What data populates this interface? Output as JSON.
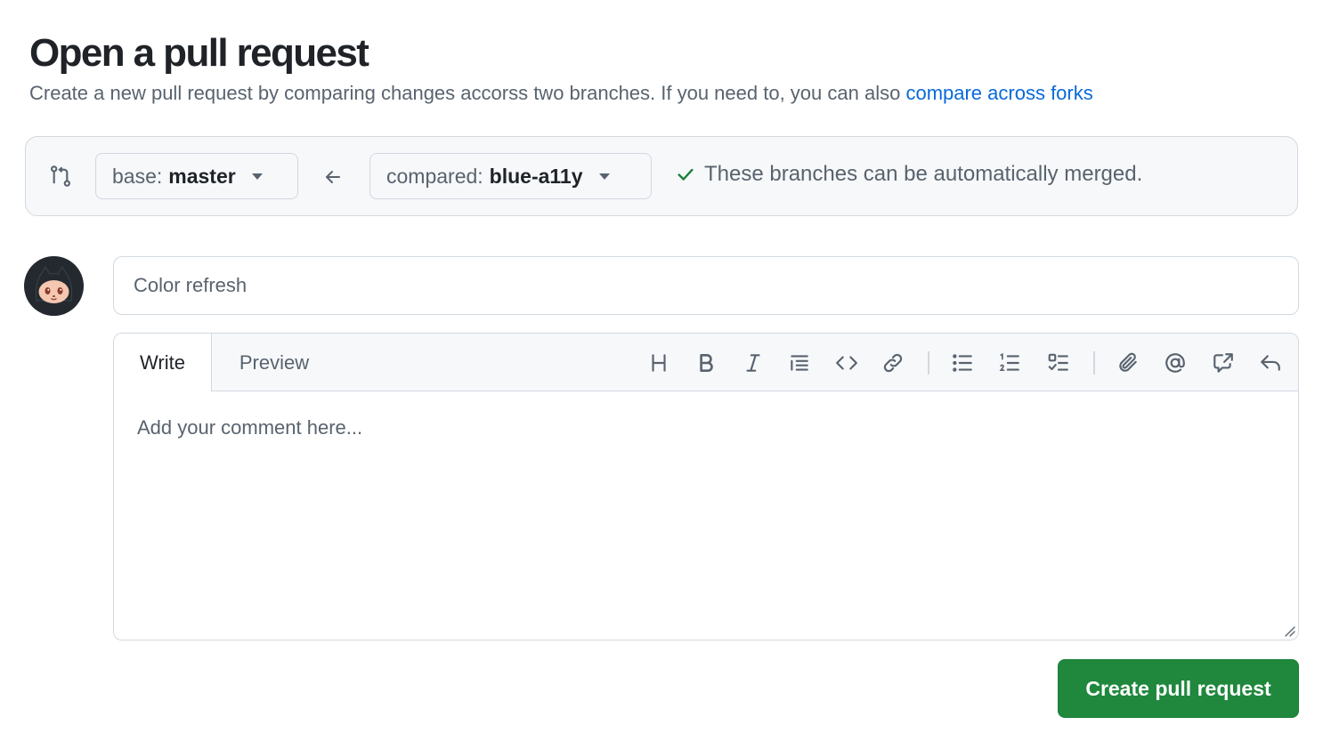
{
  "header": {
    "title": "Open a pull request",
    "subtitle": "Create a new pull request by comparing changes accorss two branches. If you need to, you can also ",
    "subtitle_link": "compare across forks"
  },
  "compare": {
    "base_prefix": "base:",
    "base_branch": "master",
    "compared_prefix": "compared:",
    "compared_branch": "blue-a11y",
    "merge_status": "These branches can be automatically merged.",
    "status_color": "#1a7f37",
    "icons": [
      "git-compare-icon",
      "arrow-left-icon",
      "check-icon",
      "triangle-down-icon"
    ]
  },
  "form": {
    "title_value": "",
    "title_placeholder": "Color refresh",
    "tabs": [
      {
        "label": "Write",
        "selected": true
      },
      {
        "label": "Preview",
        "selected": false
      }
    ],
    "toolbar_icons": [
      "heading-icon",
      "bold-icon",
      "italic-icon",
      "quote-icon",
      "code-icon",
      "link-icon",
      "unordered-list-icon",
      "ordered-list-icon",
      "tasklist-icon",
      "paperclip-icon",
      "mention-icon",
      "cross-reference-icon",
      "reply-icon"
    ],
    "comment_placeholder": "Add your comment here...",
    "submit_label": "Create pull request"
  },
  "colors": {
    "primary_button": "#1f883d",
    "link": "#0969da",
    "muted_text": "#59636e"
  }
}
